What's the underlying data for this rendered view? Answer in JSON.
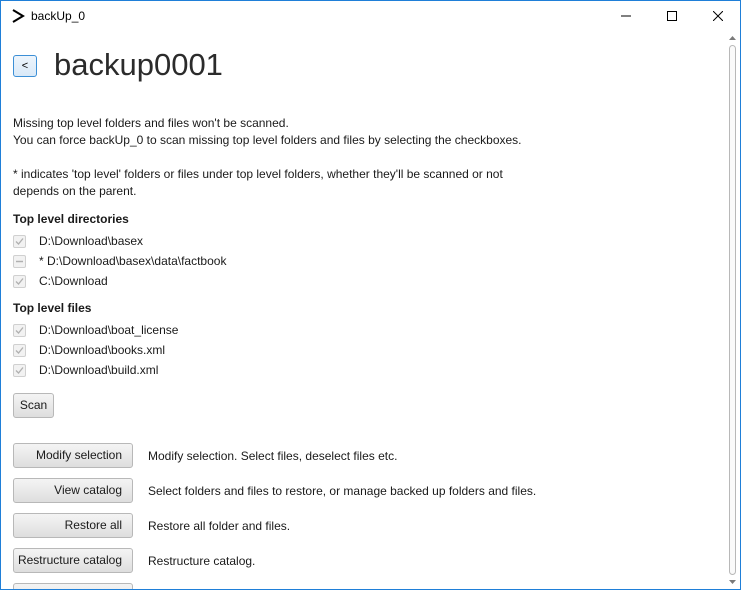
{
  "window": {
    "title": "backUp_0",
    "icon": "chevron-right-logo-icon",
    "controls": [
      "minimize-icon",
      "maximize-icon",
      "close-icon"
    ]
  },
  "header": {
    "back_label": "<",
    "title": "backup0001"
  },
  "info": {
    "line1": "Missing top level folders and files won't be scanned.",
    "line2": "You can force backUp_0 to scan missing top level folders and files by selecting the checkboxes.",
    "line3": "* indicates 'top level' folders or files under top level folders, whether they'll be scanned or not depends on the parent."
  },
  "directories": {
    "heading": "Top level directories",
    "items": [
      {
        "label": "D:\\Download\\basex",
        "state": "checked"
      },
      {
        "label": "* D:\\Download\\basex\\data\\factbook",
        "state": "indeterminate"
      },
      {
        "label": "C:\\Download",
        "state": "checked"
      }
    ]
  },
  "files": {
    "heading": "Top level files",
    "items": [
      {
        "label": "D:\\Download\\boat_license",
        "state": "checked"
      },
      {
        "label": "D:\\Download\\books.xml",
        "state": "checked"
      },
      {
        "label": "D:\\Download\\build.xml",
        "state": "checked"
      }
    ]
  },
  "scan_label": "Scan",
  "actions": [
    {
      "label": "Modify selection",
      "description": "Modify selection. Select files, deselect files etc."
    },
    {
      "label": "View catalog",
      "description": "Select folders and files to restore, or manage backed up folders and files."
    },
    {
      "label": "Restore all",
      "description": "Restore all folder and files."
    },
    {
      "label": "Restructure catalog",
      "description": "Restructure catalog."
    }
  ],
  "colors": {
    "window_border": "#1f7fd8",
    "back_button_border": "#3c8fd6",
    "checkbox_disabled": "#b0b0b0"
  }
}
